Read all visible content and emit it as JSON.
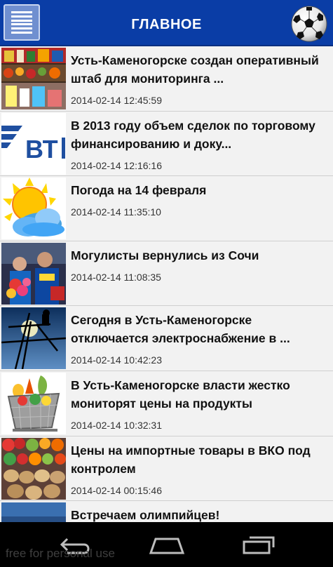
{
  "header": {
    "title": "ГЛАВНОЕ",
    "menu_icon": "menu-list-icon",
    "ball_icon": "soccer-ball-icon"
  },
  "news": [
    {
      "title": " Усть-Каменогорске создан оперативный штаб для мониторинга ...",
      "date": "2014-02-14 12:45:59",
      "thumb": "market-goods"
    },
    {
      "title": "В 2013 году объем сделок по торговому финансированию и доку...",
      "date": "2014-02-14 12:16:16",
      "thumb": "vtb-logo"
    },
    {
      "title": "Погода на 14 февраля",
      "date": "2014-02-14 11:35:10",
      "thumb": "sun-cloud"
    },
    {
      "title": "Могулисты вернулись из Сочи",
      "date": "2014-02-14 11:08:35",
      "thumb": "athletes-flowers"
    },
    {
      "title": "Сегодня в Усть-Каменогорске отключается электроснабжение в ...",
      "date": "2014-02-14 10:42:23",
      "thumb": "power-line-worker"
    },
    {
      "title": "В Усть-Каменогорске власти жестко мониторят цены на продукты",
      "date": "2014-02-14 10:32:31",
      "thumb": "grocery-basket"
    },
    {
      "title": "Цены на импортные товары в ВКО под контролем",
      "date": "2014-02-14 00:15:46",
      "thumb": "vegetables"
    },
    {
      "title": "Встречаем олимпийцев!",
      "date": "",
      "thumb": "unknown"
    }
  ],
  "navbar": {
    "back_icon": "back-icon",
    "home_icon": "home-icon",
    "recents_icon": "recent-apps-icon"
  },
  "watermark": "free for personal use",
  "colors": {
    "header_bg": "#0a3da6",
    "list_bg": "#f2f2f2",
    "navbar_bg": "#000000"
  }
}
